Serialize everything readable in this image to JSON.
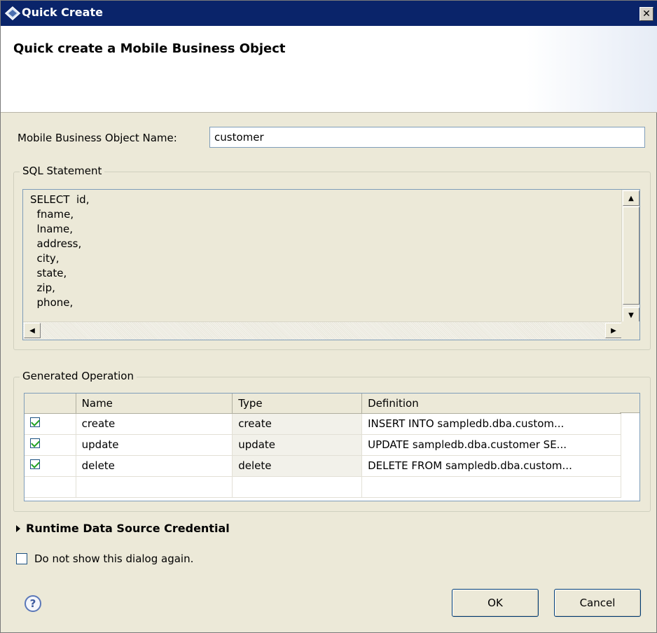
{
  "window": {
    "title": "Quick Create",
    "close_glyph": "✕"
  },
  "banner": {
    "title": "Quick create a Mobile Business Object"
  },
  "name_field": {
    "label": "Mobile Business Object Name:",
    "value": "customer"
  },
  "sql": {
    "legend": "SQL Statement",
    "lines": [
      "SELECT  id,",
      "  fname,",
      "  lname,",
      "  address,",
      "  city,",
      "  state,",
      "  zip,",
      "  phone,"
    ]
  },
  "operations": {
    "legend": "Generated Operation",
    "columns": [
      "",
      "Name",
      "Type",
      "Definition"
    ],
    "rows": [
      {
        "checked": true,
        "name": "create",
        "type": "create",
        "definition": "INSERT INTO sampledb.dba.custom..."
      },
      {
        "checked": true,
        "name": "update",
        "type": "update",
        "definition": "UPDATE sampledb.dba.customer SE..."
      },
      {
        "checked": true,
        "name": "delete",
        "type": "delete",
        "definition": "DELETE FROM sampledb.dba.custom..."
      }
    ]
  },
  "runtime": {
    "label": "Runtime Data Source Credential",
    "expanded": false
  },
  "dont_show": {
    "label": "Do not show this dialog again.",
    "checked": false
  },
  "buttons": {
    "ok": "OK",
    "cancel": "Cancel"
  },
  "icons": {
    "help": "?",
    "title": "app-icon"
  },
  "colors": {
    "titlebar": "#0a246a",
    "dialog_bg": "#ece9d8"
  }
}
